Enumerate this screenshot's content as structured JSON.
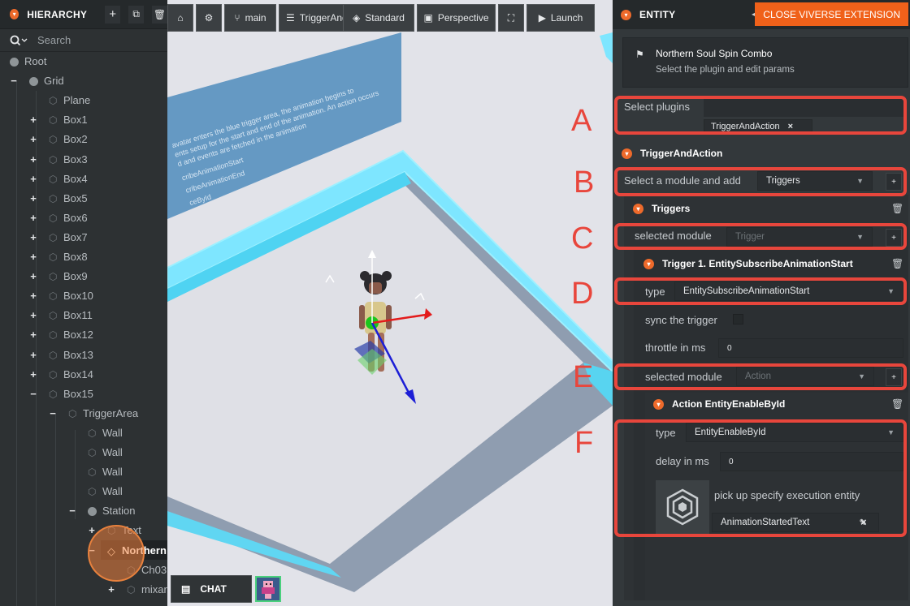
{
  "hierarchy": {
    "title": "HIERARCHY",
    "search_placeholder": "Search",
    "items": [
      {
        "label": "Root"
      },
      {
        "label": "Grid"
      },
      {
        "label": "Plane"
      },
      {
        "label": "Box1"
      },
      {
        "label": "Box2"
      },
      {
        "label": "Box3"
      },
      {
        "label": "Box4"
      },
      {
        "label": "Box5"
      },
      {
        "label": "Box6"
      },
      {
        "label": "Box7"
      },
      {
        "label": "Box8"
      },
      {
        "label": "Box9"
      },
      {
        "label": "Box10"
      },
      {
        "label": "Box11"
      },
      {
        "label": "Box12"
      },
      {
        "label": "Box13"
      },
      {
        "label": "Box14"
      },
      {
        "label": "Box15"
      },
      {
        "label": "TriggerArea"
      },
      {
        "label": "Wall"
      },
      {
        "label": "Wall"
      },
      {
        "label": "Wall"
      },
      {
        "label": "Wall"
      },
      {
        "label": "Station"
      },
      {
        "label": "Text"
      },
      {
        "label": "Northern"
      },
      {
        "label": "Ch03"
      },
      {
        "label": "mixar"
      }
    ]
  },
  "toolbar": {
    "branch": "main",
    "scene": "TriggerAnd",
    "standard": "Standard",
    "perspective": "Perspective",
    "launch": "Launch"
  },
  "viewport": {
    "chat": "CHAT",
    "floating_text": [
      "avatar enters the blue trigger area, the animation begins to",
      "ents setup for the start and end of the animation. An action occurs",
      "d and events are fetched in the animation",
      "cribeAnimationStart",
      "cribeAnimationEnd",
      "ceById"
    ]
  },
  "entity": {
    "title": "ENTITY",
    "close_extension": "CLOSE VIVERSE EXTENSION",
    "name": "Northern Soul Spin Combo",
    "description": "Select the plugin and edit params",
    "select_plugins_label": "Select plugins",
    "plugin_tag": "TriggerAndAction",
    "plugin_section": "TriggerAndAction",
    "select_module_label": "Select a module and add",
    "select_module_value": "Triggers",
    "triggers_section": "Triggers",
    "selected_module_label": "selected module",
    "selected_module_trigger": "Trigger",
    "trigger_item_title": "Trigger 1. EntitySubscribeAnimationStart",
    "type_label": "type",
    "trigger_type": "EntitySubscribeAnimationStart",
    "sync_trigger_label": "sync the trigger",
    "throttle_label": "throttle in ms",
    "throttle_value": "0",
    "selected_module_action": "Action",
    "action_item_title": "Action EntityEnableById",
    "action_type": "EntityEnableById",
    "delay_label": "delay in ms",
    "delay_value": "0",
    "pickup_label": "pick up specify execution entity",
    "pickup_value": "AnimationStartedText"
  },
  "annotations": [
    "A",
    "B",
    "C",
    "D",
    "E",
    "F"
  ],
  "colors": {
    "accent_orange": "#f0611a",
    "annotation_red": "#e8463c",
    "trigger_cyan": "#55d8f5"
  }
}
